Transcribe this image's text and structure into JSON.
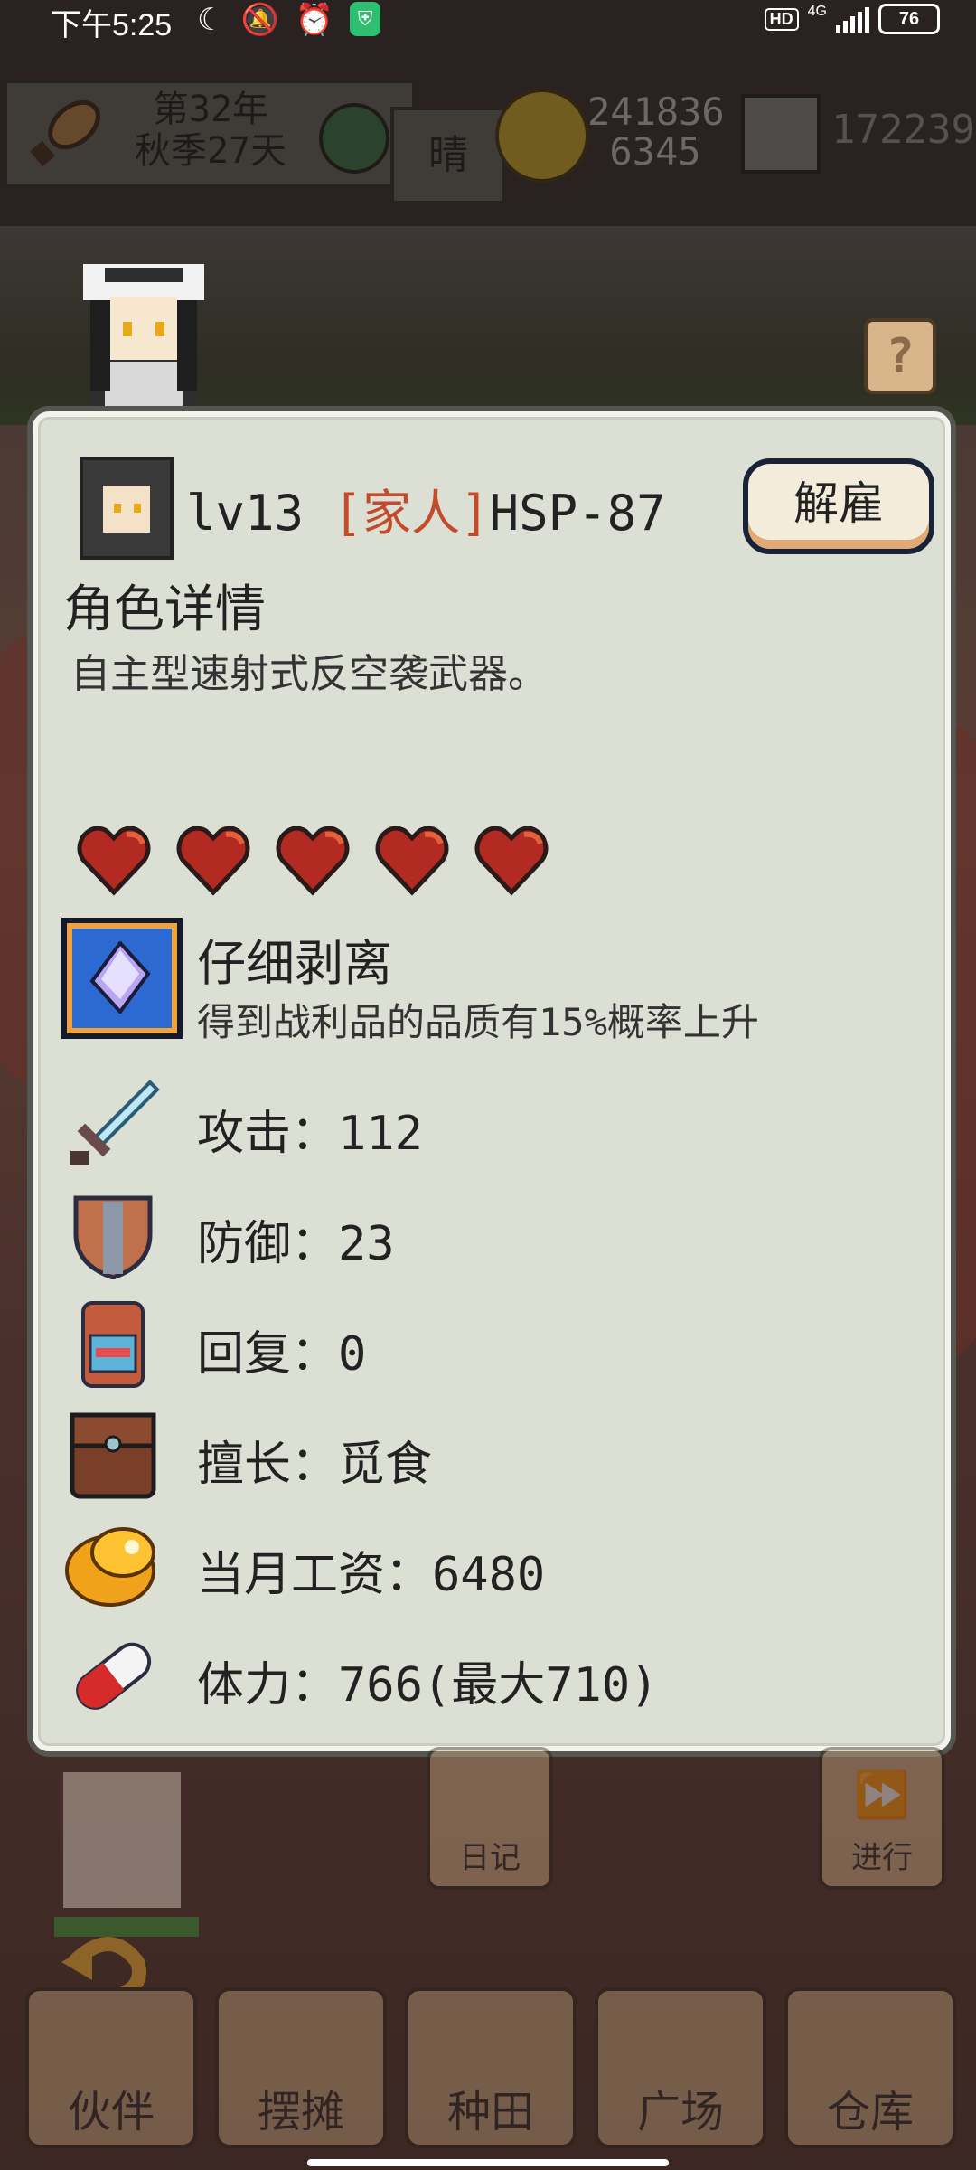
{
  "status_bar": {
    "time": "下午5:25",
    "hd": "HD",
    "network": "4G",
    "battery": "76",
    "icons": [
      "moon-icon",
      "mute-bell-icon",
      "alarm-icon",
      "shield-icon"
    ]
  },
  "hud": {
    "year": "第32年",
    "season_day": "秋季27天",
    "weather": "晴",
    "money_top": "241836",
    "money_bottom": "6345",
    "stones": "172239"
  },
  "help_label": "?",
  "character": {
    "level": "lv13",
    "relation": "[家人]",
    "name": "HSP-87",
    "fire_button": "解雇",
    "section_title": "角色详情",
    "description": "自主型速射式反空袭武器。",
    "hearts": 5,
    "heart_color": "#b22a22"
  },
  "skill": {
    "name": "仔细剥离",
    "description": "得到战利品的品质有15%概率上升"
  },
  "stats": {
    "attack": "攻击：112",
    "defense": "防御：23",
    "recovery": "回复：0",
    "specialty": "擅长：觅食",
    "salary": "当月工资：6480",
    "stamina": "体力：766(最大710)"
  },
  "bottom": {
    "diary": "日记",
    "proceed": "进行",
    "nav": [
      "伙伴",
      "摆摊",
      "种田",
      "广场",
      "仓库"
    ]
  }
}
